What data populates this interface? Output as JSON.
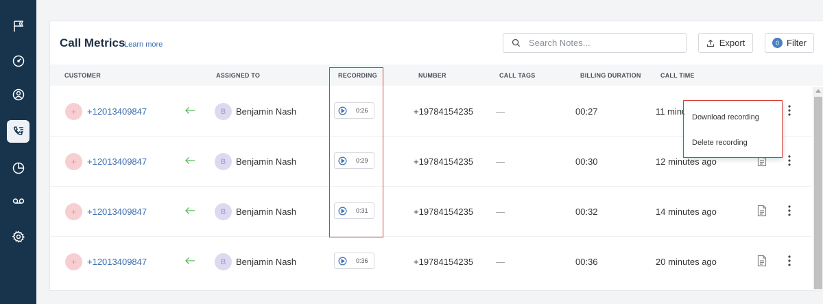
{
  "sidebar": {
    "items": [
      {
        "icon": "flag-icon"
      },
      {
        "icon": "dashboard-gauge-icon"
      },
      {
        "icon": "user-circle-icon"
      },
      {
        "icon": "phone-list-icon",
        "active": true
      },
      {
        "icon": "pie-chart-icon"
      },
      {
        "icon": "voicemail-icon"
      },
      {
        "icon": "settings-gear-icon"
      }
    ]
  },
  "header": {
    "title": "Call Metrics",
    "learn_more": "Learn more",
    "search_placeholder": "Search Notes...",
    "export_label": "Export",
    "filter_label": "Filter",
    "filter_count": "0"
  },
  "columns": {
    "customer": "CUSTOMER",
    "assigned_to": "ASSIGNED TO",
    "recording": "RECORDING",
    "number": "NUMBER",
    "call_tags": "CALL TAGS",
    "billing_duration": "BILLING DURATION",
    "call_time": "CALL TIME"
  },
  "rows": [
    {
      "customer": "+12013409847",
      "avatar_initial": "+",
      "agent_initial": "B",
      "agent": "Benjamin Nash",
      "recording": "0:26",
      "number": "+19784154235",
      "tags": "—",
      "billing": "00:27",
      "call_time": "11 minutes ago"
    },
    {
      "customer": "+12013409847",
      "avatar_initial": "+",
      "agent_initial": "B",
      "agent": "Benjamin Nash",
      "recording": "0:29",
      "number": "+19784154235",
      "tags": "—",
      "billing": "00:30",
      "call_time": "12 minutes ago"
    },
    {
      "customer": "+12013409847",
      "avatar_initial": "+",
      "agent_initial": "B",
      "agent": "Benjamin Nash",
      "recording": "0:31",
      "number": "+19784154235",
      "tags": "—",
      "billing": "00:32",
      "call_time": "14 minutes ago"
    },
    {
      "customer": "+12013409847",
      "avatar_initial": "+",
      "agent_initial": "B",
      "agent": "Benjamin Nash",
      "recording": "0:36",
      "number": "+19784154235",
      "tags": "—",
      "billing": "00:36",
      "call_time": "20 minutes ago"
    }
  ],
  "menu": {
    "download": "Download recording",
    "delete": "Delete recording"
  },
  "colors": {
    "sidebar_bg": "#17344c",
    "link_blue": "#3d6fb0",
    "highlight_red": "#d63b32",
    "inbound_arrow_green": "#5cb85c"
  }
}
